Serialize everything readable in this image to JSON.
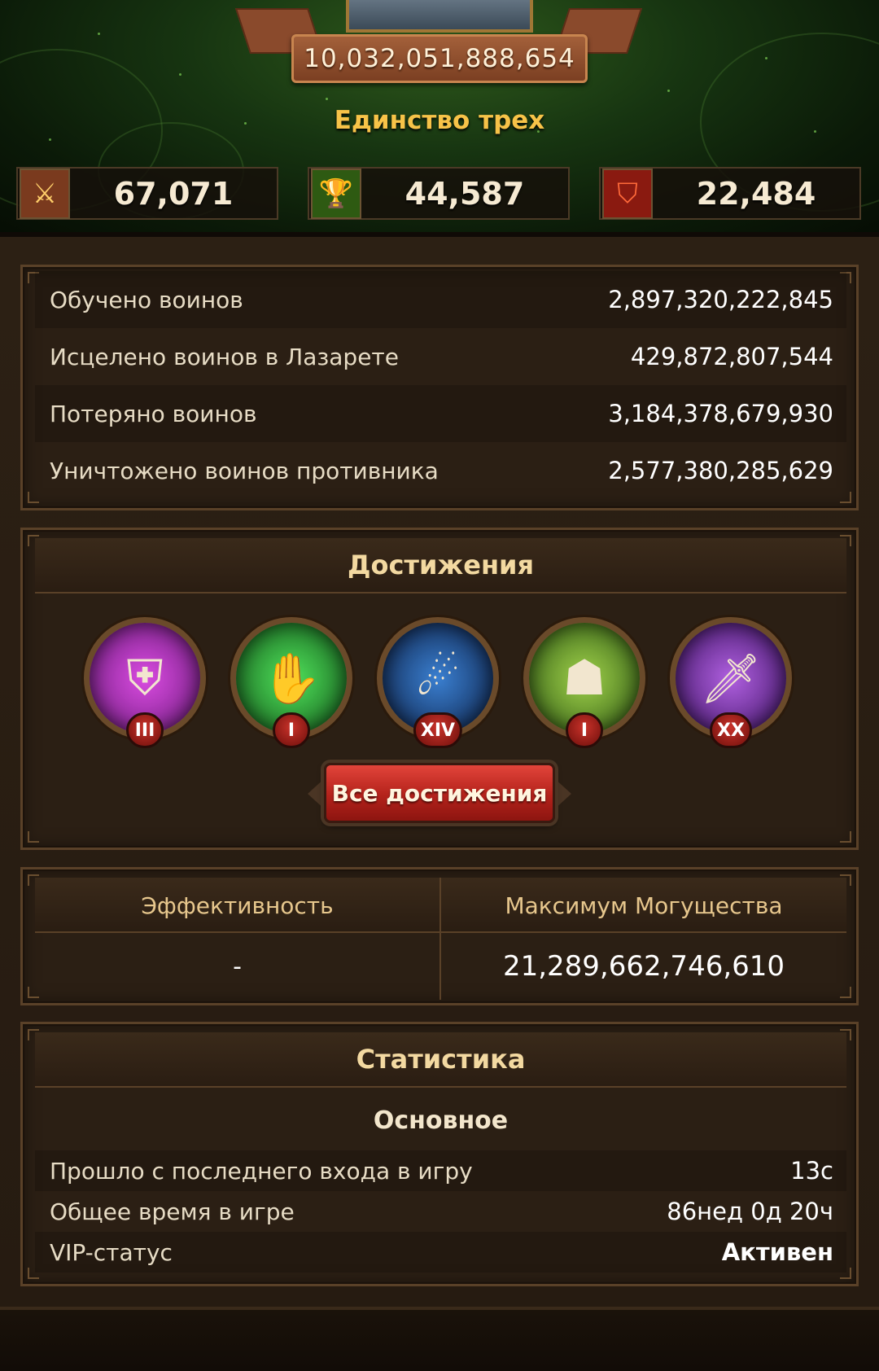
{
  "header": {
    "power": "10,032,051,888,654",
    "alliance": "Единство трех",
    "stats": [
      {
        "icon": "crossed-swords-icon",
        "value": "67,071"
      },
      {
        "icon": "trophy-icon",
        "value": "44,587"
      },
      {
        "icon": "broken-shield-icon",
        "value": "22,484"
      }
    ]
  },
  "troops": {
    "rows": [
      {
        "label": "Обучено воинов",
        "value": "2,897,320,222,845"
      },
      {
        "label": "Исцелено воинов в Лазарете",
        "value": "429,872,807,544"
      },
      {
        "label": "Потеряно воинов",
        "value": "3,184,378,679,930"
      },
      {
        "label": "Уничтожено воинов противника",
        "value": "2,577,380,285,629"
      }
    ]
  },
  "achievements": {
    "title": "Достижения",
    "badges": [
      {
        "icon": "helmet-swords-icon",
        "rank": "III"
      },
      {
        "icon": "hand-building-icon",
        "rank": "I"
      },
      {
        "icon": "meteor-icon",
        "rank": "XIV"
      },
      {
        "icon": "stone-golem-icon",
        "rank": "I"
      },
      {
        "icon": "flaming-sword-icon",
        "rank": "XX"
      }
    ],
    "all_button": "Все достижения"
  },
  "efficiency": {
    "left_header": "Эффективность",
    "right_header": "Максимум Могущества",
    "left_value": "-",
    "right_value": "21,289,662,746,610"
  },
  "statistics": {
    "title": "Статистика",
    "subtitle": "Основное",
    "rows": [
      {
        "label": "Прошло с последнего входа в игру",
        "value": "13с"
      },
      {
        "label": "Общее время в игре",
        "value": "86нед 0д 20ч"
      },
      {
        "label": "VIP-статус",
        "value": "Активен"
      }
    ]
  }
}
